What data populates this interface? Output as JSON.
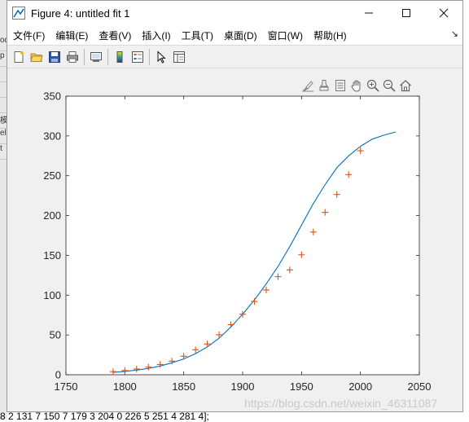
{
  "window": {
    "title": "Figure 4: untitled fit 1",
    "controls": {
      "minimize": "—",
      "maximize": "☐",
      "close": "✕"
    }
  },
  "menu": {
    "items": [
      "文件(F)",
      "编辑(E)",
      "查看(V)",
      "插入(I)",
      "工具(T)",
      "桌面(D)",
      "窗口(W)",
      "帮助(H)"
    ],
    "overflow_arrow": "↘"
  },
  "toolbar": {
    "icons": [
      "new-figure-icon",
      "open-file-icon",
      "save-icon",
      "print-icon",
      "link-plot-icon",
      "insert-colorbar-icon",
      "insert-legend-icon",
      "edit-plot-icon",
      "property-inspector-icon"
    ]
  },
  "axes_toolbar": {
    "icons": [
      "brush-icon",
      "data-tips-icon",
      "restore-view-icon",
      "pan-icon",
      "zoom-in-icon",
      "zoom-out-icon",
      "home-icon"
    ]
  },
  "chart_data": {
    "type": "line",
    "xlim": [
      1750,
      2050
    ],
    "ylim": [
      0,
      350
    ],
    "xticks": [
      1750,
      1800,
      1850,
      1900,
      1950,
      2000,
      2050
    ],
    "yticks": [
      0,
      50,
      100,
      150,
      200,
      250,
      300,
      350
    ],
    "grid": false,
    "series": [
      {
        "style": "markers-plus",
        "color": "#D95319",
        "x": [
          1790,
          1800,
          1810,
          1820,
          1830,
          1840,
          1850,
          1860,
          1870,
          1880,
          1890,
          1900,
          1910,
          1920,
          1930,
          1940,
          1950,
          1960,
          1970,
          1980,
          1990,
          2000
        ],
        "y": [
          3.9,
          5.3,
          7.2,
          9.6,
          12.9,
          17.1,
          23.2,
          31.4,
          38.6,
          50.2,
          62.9,
          76.0,
          92.0,
          106.5,
          123.2,
          131.7,
          150.7,
          179.3,
          204.0,
          226.5,
          251.4,
          281.4
        ]
      },
      {
        "style": "line",
        "color": "#0072BD",
        "x": [
          1790,
          1800,
          1810,
          1820,
          1830,
          1840,
          1850,
          1860,
          1870,
          1880,
          1890,
          1900,
          1910,
          1920,
          1930,
          1940,
          1950,
          1960,
          1970,
          1980,
          1990,
          2000,
          2010,
          2020,
          2030
        ],
        "y": [
          3,
          4.2,
          5.8,
          8,
          11,
          15,
          20,
          26.5,
          35,
          46,
          60,
          76,
          94,
          114,
          136,
          161,
          188,
          215,
          239,
          260,
          275,
          287,
          296,
          301,
          305
        ]
      }
    ]
  },
  "watermark": "https://blog.csdn.net/weixin_46311087",
  "bottom_text": "8 2 131 7 150 7 179 3 204 0 226 5 251 4 281 4];",
  "left_strip": [
    "oc",
    "p",
    "",
    "",
    "",
    "模",
    "el",
    "t"
  ]
}
